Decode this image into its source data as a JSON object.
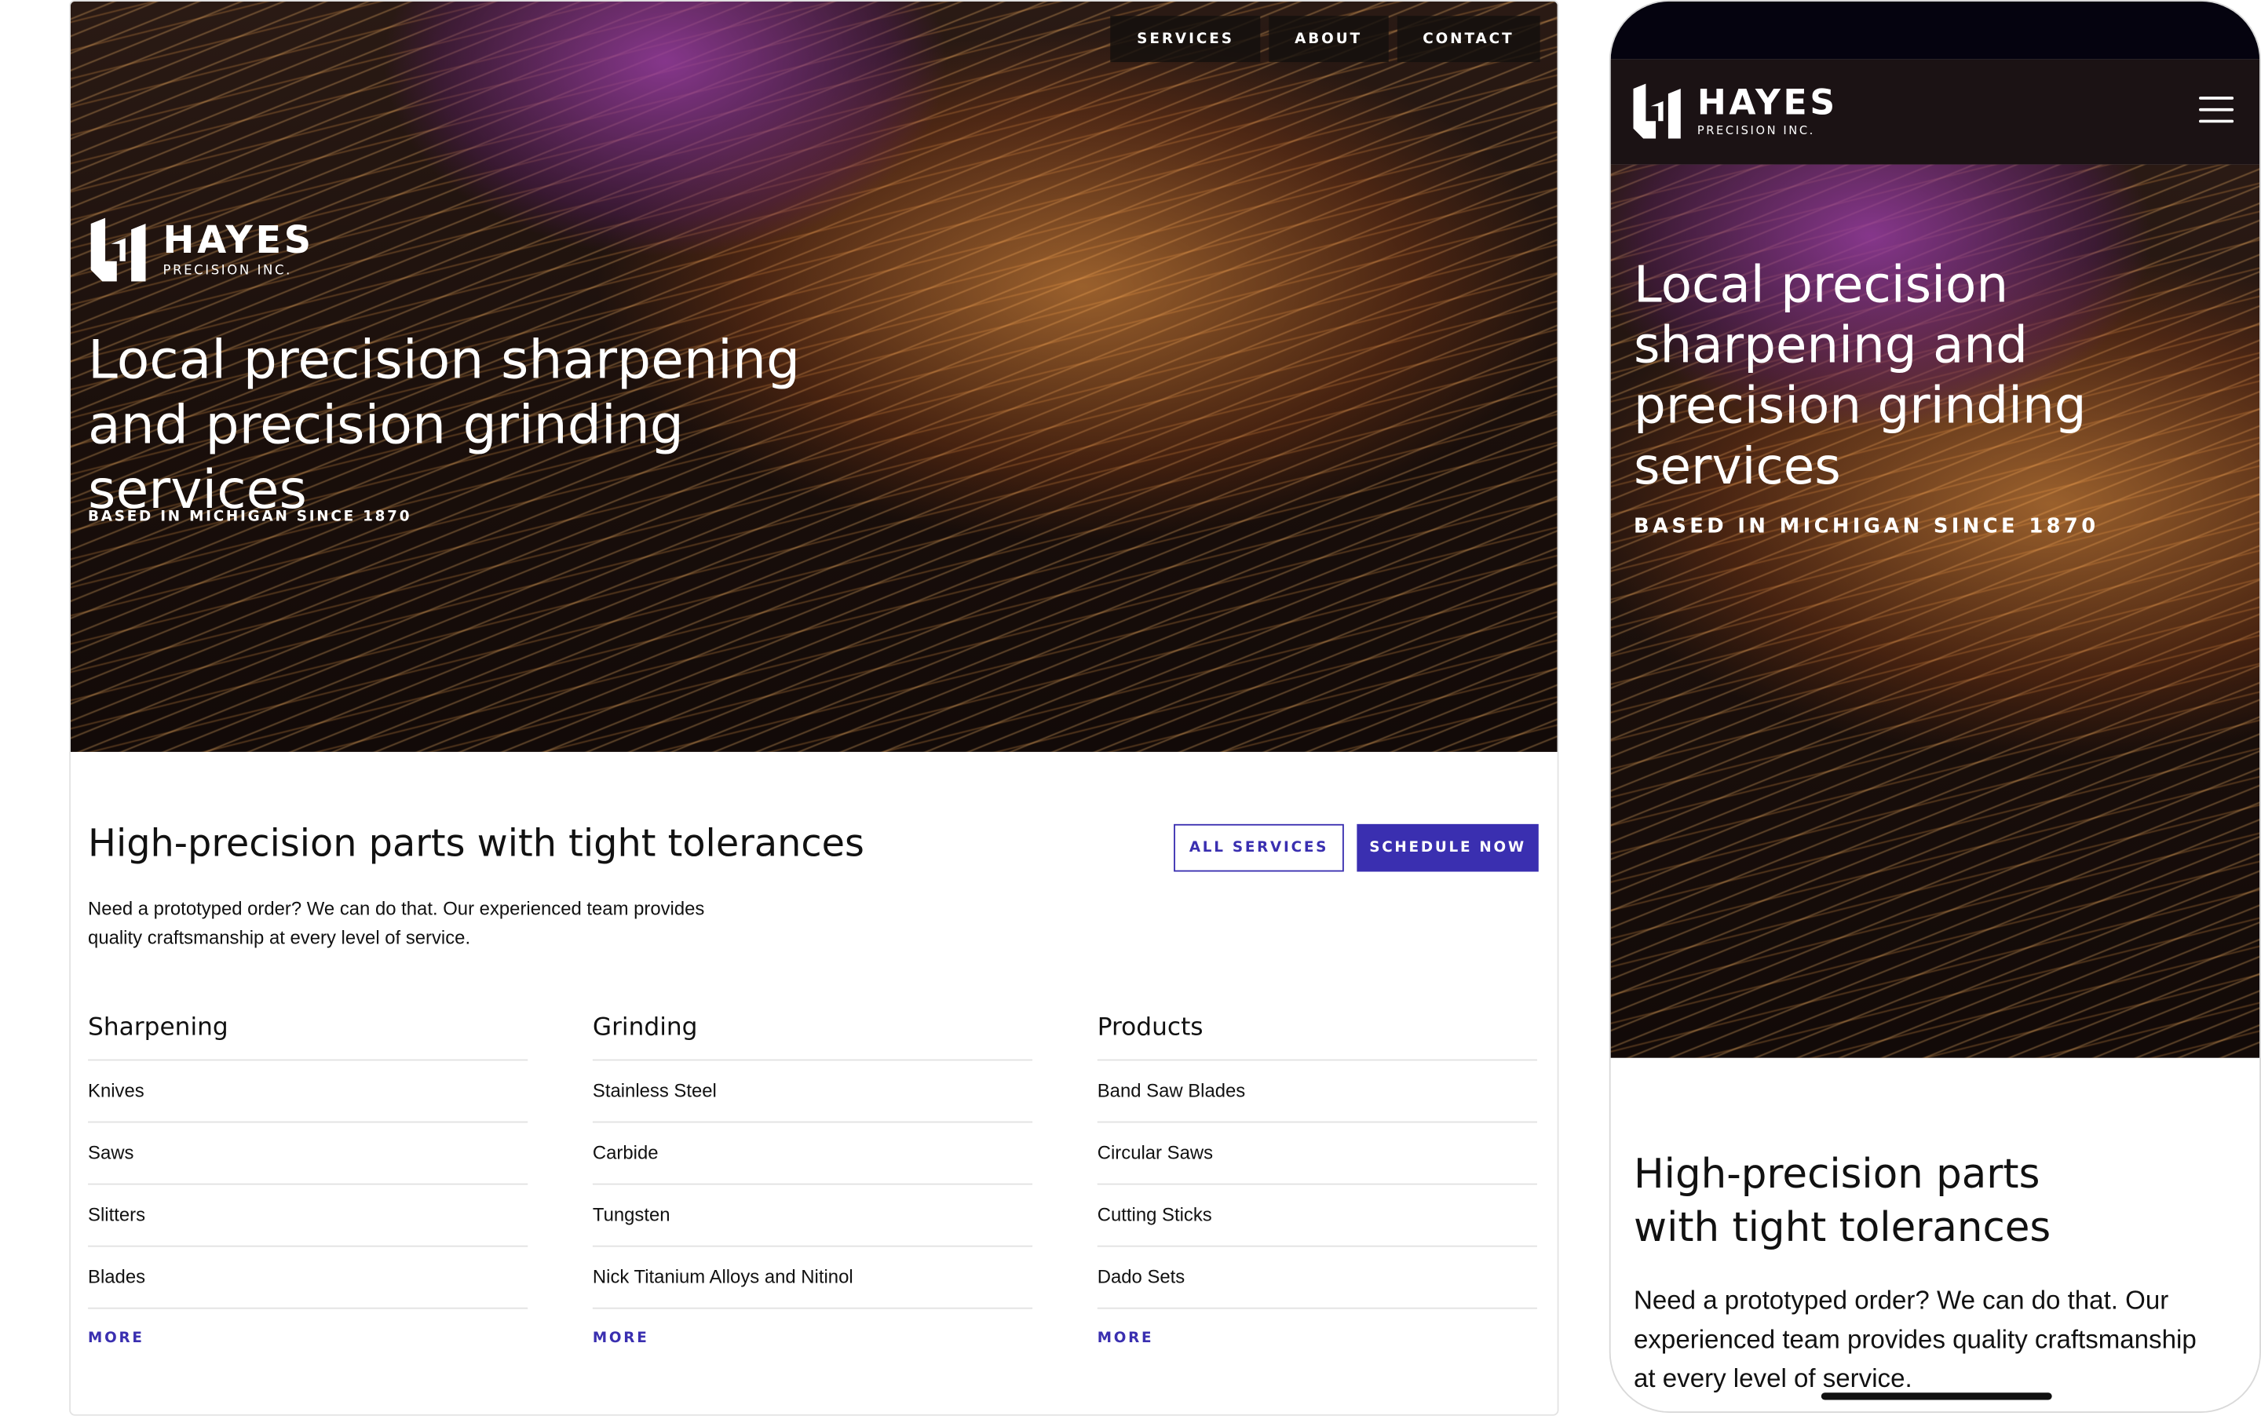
{
  "brand": {
    "name": "HAYES",
    "sub": "PRECISION INC."
  },
  "nav": [
    "SERVICES",
    "ABOUT",
    "CONTACT"
  ],
  "hero": {
    "headline": "Local precision sharpening and precision grinding services",
    "tagline": "BASED IN MICHIGAN SINCE 1870"
  },
  "intro": {
    "heading": "High-precision parts with tight tolerances",
    "body": "Need a prototyped order? We can do that. Our experienced team provides quality craftsmanship at every level of service.",
    "all_services_label": "ALL SERVICES",
    "schedule_label": "SCHEDULE NOW"
  },
  "columns": [
    {
      "title": "Sharpening",
      "items": [
        "Knives",
        "Saws",
        "Slitters",
        "Blades"
      ],
      "more": "MORE"
    },
    {
      "title": "Grinding",
      "items": [
        "Stainless Steel",
        "Carbide",
        "Tungsten",
        "Nick Titanium Alloys and Nitinol"
      ],
      "more": "MORE"
    },
    {
      "title": "Products",
      "items": [
        "Band Saw Blades",
        "Circular Saws",
        "Cutting Sticks",
        "Dado Sets"
      ],
      "more": "MORE"
    }
  ],
  "colors": {
    "accent": "#3a2fb0",
    "header_dark": "#1b1214"
  },
  "icons": [
    "hayes-logo-icon",
    "hamburger-menu-icon"
  ]
}
